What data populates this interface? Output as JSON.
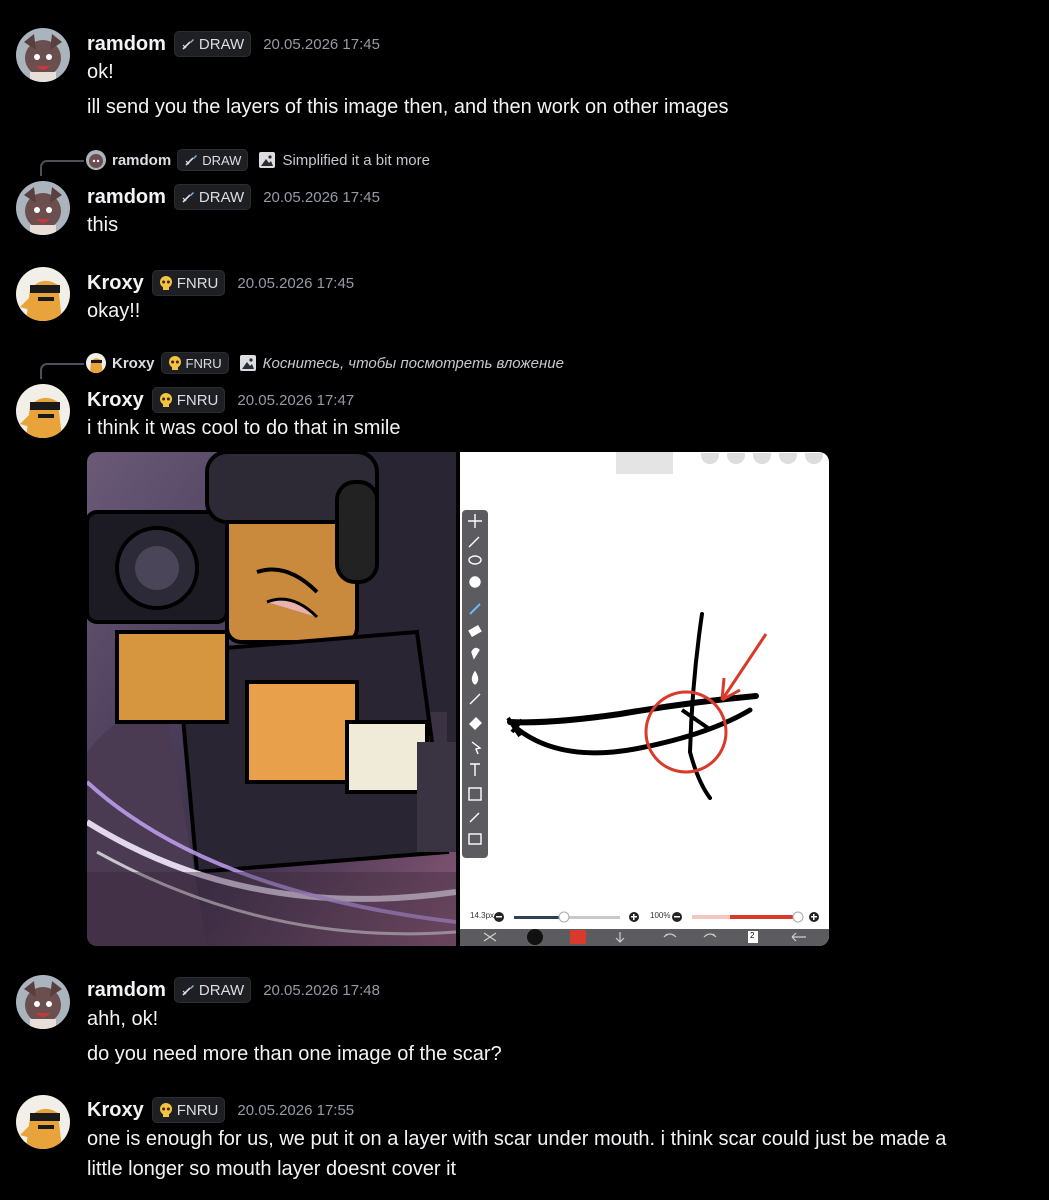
{
  "messages": [
    {
      "user": "ramdom",
      "tag": "DRAW",
      "time": "20.05.2026 17:45",
      "lines": [
        "ok!",
        "ill send you the layers of this image then, and then work on other images"
      ]
    },
    {
      "reply": {
        "user": "ramdom",
        "tag": "DRAW",
        "text": "Simplified it a bit more"
      },
      "user": "ramdom",
      "tag": "DRAW",
      "time": "20.05.2026 17:45",
      "lines": [
        "this"
      ]
    },
    {
      "user": "Kroxy",
      "tag": "FNRU",
      "time": "20.05.2026 17:45",
      "lines": [
        "okay!!"
      ]
    },
    {
      "reply": {
        "user": "Kroxy",
        "tag": "FNRU",
        "text": "Коснитесь, чтобы посмотреть вложение"
      },
      "user": "Kroxy",
      "tag": "FNRU",
      "time": "20.05.2026 17:47",
      "lines": [
        "i think it was cool to do that in smile"
      ]
    },
    {
      "user": "ramdom",
      "tag": "DRAW",
      "time": "20.05.2026 17:48",
      "lines": [
        "ahh, ok!",
        "do you need more than one image of the scar?"
      ]
    },
    {
      "user": "Kroxy",
      "tag": "FNRU",
      "time": "20.05.2026 17:55",
      "lines": [
        "one is enough for us, we put it on a layer with scar under mouth. i think scar could just be made a",
        "little longer so mouth layer doesnt cover it"
      ]
    }
  ],
  "editor": {
    "brush_size": "14.3px",
    "opacity": "100%",
    "layer_count": "2",
    "tool_labels": [
      "Преобразовать",
      "Волшебная палочка",
      "Лассо",
      "Фильтр",
      "Кисть",
      "Ластик",
      "Палец",
      "Размытие",
      "Спецэффекты",
      "Заливка",
      "Вектор",
      "Текст",
      "Разделитель",
      "Пипетка",
      "Холст"
    ]
  },
  "colors": {
    "background": "#000000",
    "tag_bg": "#1e1f22",
    "timestamp": "#949ba4",
    "accent_red": "#d83a2b"
  },
  "icons": {
    "draw_tag": "brush-icon",
    "fnru_tag": "skull-emoji-icon",
    "reply_attachment": "image-icon"
  }
}
